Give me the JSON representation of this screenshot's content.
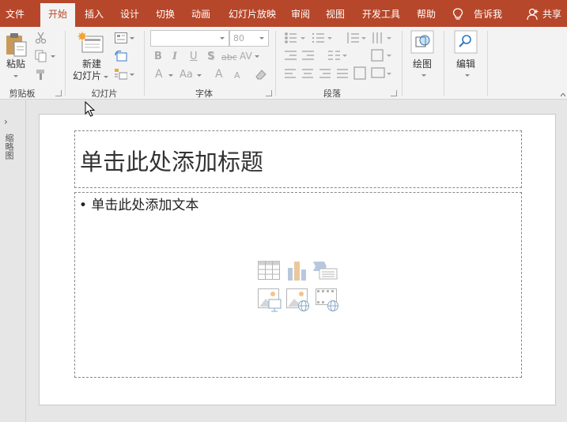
{
  "tabs": [
    {
      "label": "文件",
      "active": false
    },
    {
      "label": "开始",
      "active": true
    },
    {
      "label": "插入",
      "active": false
    },
    {
      "label": "设计",
      "active": false
    },
    {
      "label": "切换",
      "active": false
    },
    {
      "label": "动画",
      "active": false
    },
    {
      "label": "幻灯片放映",
      "active": false
    },
    {
      "label": "审阅",
      "active": false
    },
    {
      "label": "视图",
      "active": false
    },
    {
      "label": "开发工具",
      "active": false
    },
    {
      "label": "帮助",
      "active": false
    }
  ],
  "tell_me": "告诉我",
  "share": "共享",
  "ribbon": {
    "clipboard": {
      "label": "剪贴板",
      "paste": "粘贴"
    },
    "slides": {
      "label": "幻灯片",
      "new_slide_line1": "新建",
      "new_slide_line2": "幻灯片"
    },
    "font": {
      "label": "字体",
      "font_name": "",
      "font_size": "80",
      "bold": "B",
      "italic": "I",
      "underline": "U",
      "shadow": "S",
      "strike": "abc",
      "spacing": "AV",
      "font_color": "A",
      "change_case": "Aa",
      "grow": "A",
      "shrink": "A"
    },
    "paragraph": {
      "label": "段落"
    },
    "drawing": {
      "label": "绘图"
    },
    "editing": {
      "label": "编辑"
    }
  },
  "thumbnail_pane": {
    "label": "缩略图"
  },
  "slide": {
    "title_placeholder": "单击此处添加标题",
    "body_placeholder": "• 单击此处添加文本"
  },
  "colors": {
    "accent": "#b7472a",
    "ribbon_bg": "#f3f3f3",
    "canvas_bg": "#e6e6e6"
  }
}
